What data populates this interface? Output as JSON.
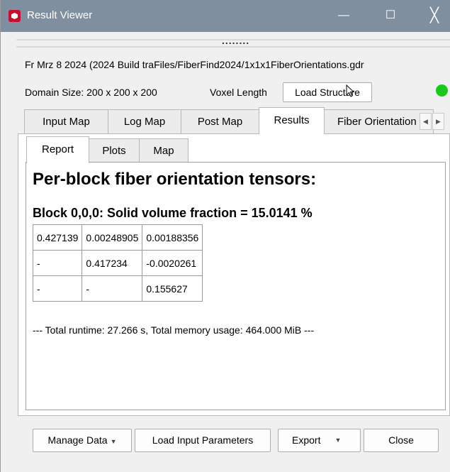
{
  "window": {
    "title": "Result Viewer",
    "minimize_glyph": "—",
    "maximize_glyph": "☐",
    "close_glyph": "╳"
  },
  "splitter_dots": "........",
  "info": {
    "build_line": "Fr Mrz 8 2024 (2024 Build  traFiles/FiberFind2024/1x1x1FiberOrientations.gdr",
    "domain_size": "Domain Size: 200 x 200 x 200",
    "voxel_length": "Voxel Length",
    "load_structure": "Load Structure",
    "status_color": "#19c919"
  },
  "tabs": [
    {
      "label": "Input Map"
    },
    {
      "label": "Log Map"
    },
    {
      "label": "Post Map"
    },
    {
      "label": "Results"
    },
    {
      "label": "Fiber Orientation"
    }
  ],
  "tab_scroll": {
    "left": "◀",
    "right": "▶"
  },
  "subtabs": [
    {
      "label": "Report"
    },
    {
      "label": "Plots"
    },
    {
      "label": "Map"
    }
  ],
  "report": {
    "title": "Per-block fiber orientation tensors:",
    "block_title": "Block 0,0,0: Solid volume fraction = 15.0141 %",
    "tensor": [
      [
        "0.427139",
        "0.00248905",
        "0.00188356"
      ],
      [
        "-",
        "0.417234",
        "-0.0020261"
      ],
      [
        "-",
        "-",
        "0.155627"
      ]
    ],
    "summary": "--- Total runtime: 27.266 s, Total memory usage: 464.000 MiB ---"
  },
  "buttons": {
    "manage_data": "Manage Data",
    "load_input": "Load Input Parameters",
    "export": "Export",
    "close": "Close",
    "dropdown_glyph": "▼"
  }
}
